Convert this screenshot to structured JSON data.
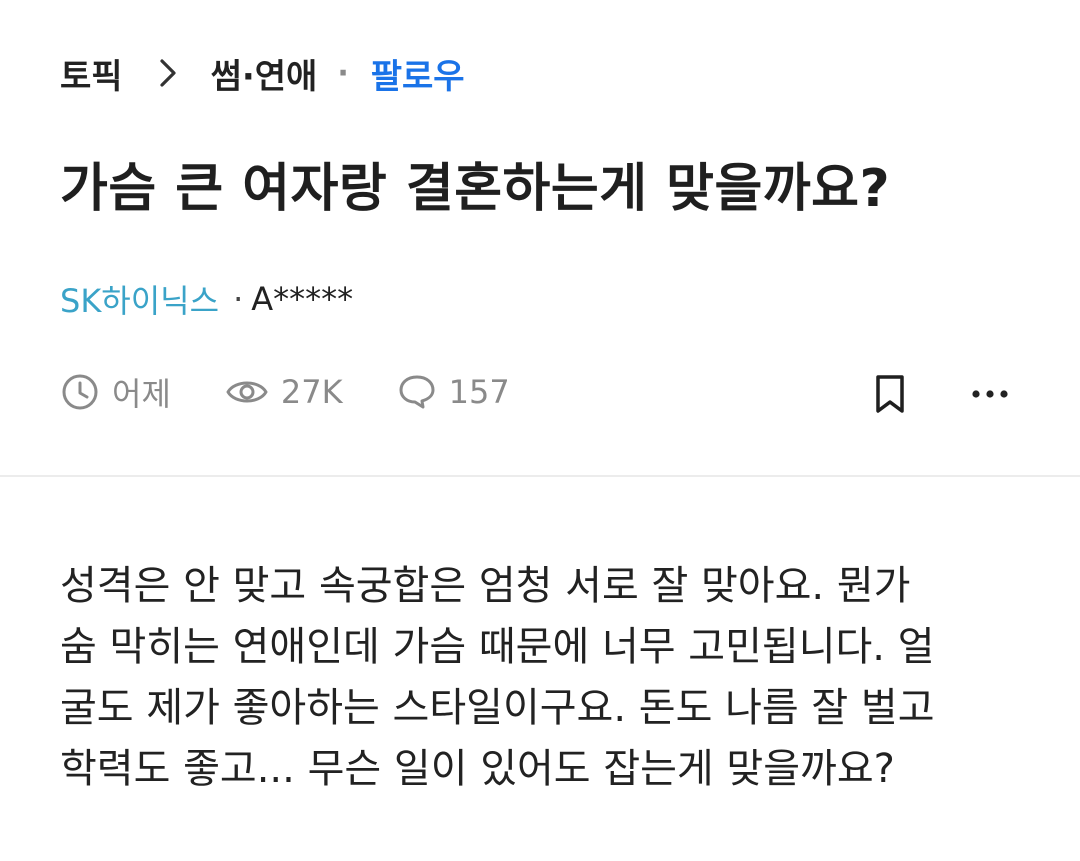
{
  "breadcrumb": {
    "root": "토픽",
    "category": "썸·연애",
    "follow": "팔로우"
  },
  "post": {
    "title": "가슴 큰 여자랑 결혼하는게 맞을까요?",
    "company": "SK하이닉스",
    "author": "A*****",
    "time": "어제",
    "views": "27K",
    "comments": "157",
    "body_lines": [
      "성격은 안 맞고 속궁합은 엄청 서로 잘 맞아요. 뭔가",
      "숨 막히는 연애인데 가슴 때문에 너무 고민됩니다. 얼",
      "굴도 제가 좋아하는 스타일이구요. 돈도 나름 잘 벌고",
      "학력도 좋고... 무슨 일이 있어도 잡는게 맞을까요?"
    ]
  },
  "icons": {
    "time": "clock-icon",
    "views": "eye-icon",
    "comments": "comment-bubble-icon",
    "bookmark": "bookmark-icon",
    "more": "more-horizontal-icon",
    "breadcrumb_separator": "chevron-right-icon"
  },
  "colors": {
    "follow_link": "#1a73e8",
    "company_link": "#3aa3c8",
    "meta_text": "#8a8a8a",
    "text": "#222222",
    "divider": "#ececec"
  }
}
